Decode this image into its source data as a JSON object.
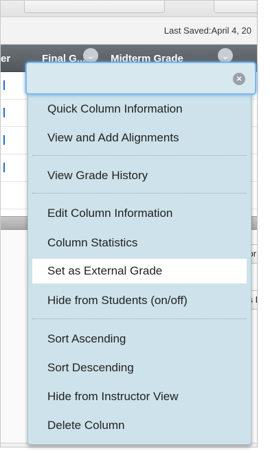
{
  "header": {
    "last_saved": "Last Saved:April 4, 20"
  },
  "grid": {
    "col_prefix": "er",
    "col_final": "Final G...",
    "col_midterm": "Midterm Grade"
  },
  "right_buttons": {
    "top": "cor",
    "bottom": "vs D"
  },
  "menu": {
    "close_icon": "circle-x-icon",
    "groups": [
      [
        "Quick Column Information",
        "View and Add Alignments"
      ],
      [
        "View Grade History"
      ],
      [
        "Edit Column Information",
        "Column Statistics",
        "Set as External Grade",
        "Hide from Students (on/off)"
      ],
      [
        "Sort Ascending",
        "Sort Descending",
        "Hide from Instructor View",
        "Delete Column"
      ]
    ],
    "highlighted_item": "Set as External Grade"
  },
  "colors": {
    "menu_bg": "#cde2ea",
    "focus_ring": "#7fb6e8",
    "header_bg": "#5e6368",
    "highlight_bg": "#ffffff"
  }
}
